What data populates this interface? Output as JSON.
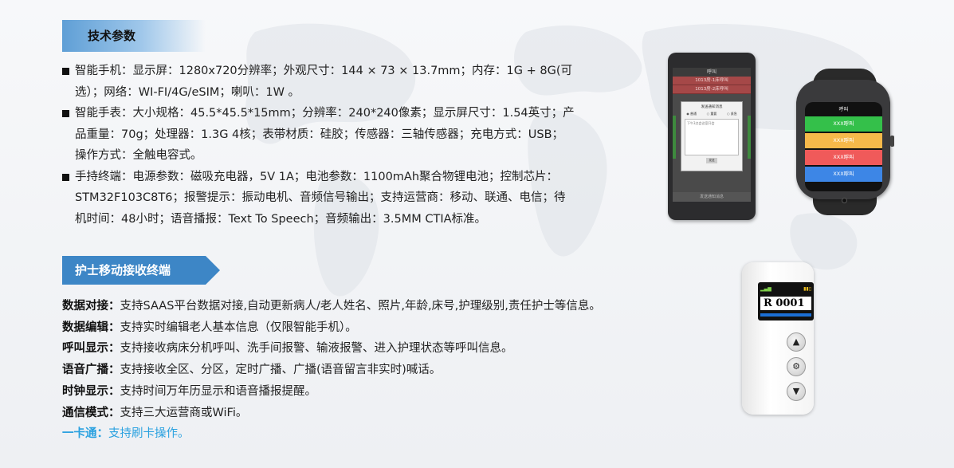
{
  "section1": {
    "title": "技术参数",
    "specs": [
      [
        "智能手机：显示屏：1280x720分辨率；外观尺寸：144 × 73 × 13.7mm；内存：1G + 8G(可",
        "选）；网络：WI-FI/4G/eSIM；喇叭：1W 。"
      ],
      [
        "智能手表：大小规格：45.5*45.5*15mm；分辨率：240*240像素；显示屏尺寸：1.54英寸；产",
        "品重量：70g；处理器：1.3G 4核；表带材质：硅胶；传感器：三轴传感器；充电方式：USB；",
        "操作方式：全触电容式。"
      ],
      [
        "手持终端：电源参数：磁吸充电器，5V 1A；电池参数：1100mAh聚合物锂电池；控制芯片：",
        "STM32F103C8T6；报警提示：振动电机、音频信号输出；支持运营商：移动、联通、电信；待",
        "机时间：48小时；语音播报：Text To Speech；音频输出：3.5MM CTIA标准。"
      ]
    ]
  },
  "section2": {
    "title": "护士移动接收终端",
    "features": [
      {
        "label": "数据对接：",
        "text": "支持SAAS平台数据对接,自动更新病人/老人姓名、照片,年龄,床号,护理级别,责任护士等信息。"
      },
      {
        "label": "数据编辑：",
        "text": "支持实时编辑老人基本信息（仅限智能手机）。"
      },
      {
        "label": "呼叫显示：",
        "text": "支持接收病床分机呼叫、洗手间报警、输液报警、进入护理状态等呼叫信息。"
      },
      {
        "label": "语音广播：",
        "text": "支持接收全区、分区，定时广播、广播(语音留言非实时)喊话。"
      },
      {
        "label": "时钟显示：",
        "text": "支持时间万年历显示和语音播报提醒。"
      },
      {
        "label": "通信模式：",
        "text": "支持三大运营商或WiFi。"
      },
      {
        "label": "一卡通：",
        "text": "支持刷卡操作。"
      }
    ]
  },
  "phone": {
    "title": "呼叫",
    "rows": [
      "1013房-1床呼叫",
      "1013房-2床呼叫"
    ],
    "dialog_title": "发送通知消息",
    "radios": [
      "普通",
      "重要",
      "紧急"
    ],
    "textarea": "下午3点会议室开会",
    "send": "发送",
    "bottom": "发送通知消息"
  },
  "watch": {
    "title": "呼叫",
    "buttons": [
      {
        "label": "XXX呼叫",
        "color": "#34c04a"
      },
      {
        "label": "XXX呼叫",
        "color": "#f6b94a"
      },
      {
        "label": "XXX呼叫",
        "color": "#f05a5a"
      },
      {
        "label": "XXX呼叫",
        "color": "#3d86e6"
      }
    ]
  },
  "handheld": {
    "code": "R 0001"
  },
  "colors": {
    "accent": "#3d86c6",
    "link": "#2aa1e0"
  }
}
